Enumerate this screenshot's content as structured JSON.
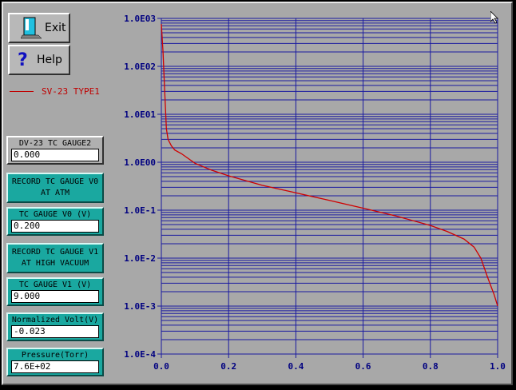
{
  "buttons": {
    "exit": "Exit",
    "help": "Help"
  },
  "legend": {
    "label": "SV-23 TYPE1",
    "color": "#c00000"
  },
  "panels": {
    "dv23": {
      "label": "DV-23 TC GAUGE2",
      "value": "0.000"
    },
    "record_v0": {
      "line1": "RECORD TC GAUGE V0",
      "line2": "AT ATM"
    },
    "tc_v0": {
      "label": "TC GAUGE V0 (V)",
      "value": "0.200"
    },
    "record_v1": {
      "line1": "RECORD TC GAUGE V1",
      "line2": "AT HIGH VACUUM"
    },
    "tc_v1": {
      "label": "TC GAUGE V1 (V)",
      "value": "9.000"
    },
    "norm_volt": {
      "label": "Normalized Volt(V)",
      "value": "-0.023"
    },
    "pressure": {
      "label": "Pressure(Torr)",
      "value": "7.6E+02"
    }
  },
  "chart_data": {
    "type": "line",
    "y_scale": "log",
    "ylim": [
      0.0001,
      1000
    ],
    "xlim": [
      0,
      1
    ],
    "y_tick_labels": [
      "1.0E03",
      "1.0E02",
      "1.0E01",
      "1.0E00",
      "1.0E-1",
      "1.0E-2",
      "1.0E-3",
      "1.0E-4"
    ],
    "x_tick_labels": [
      "0.0",
      "0.2",
      "0.4",
      "0.6",
      "0.8",
      "1.0"
    ],
    "grid": true,
    "colors": {
      "grid": "#1a1aa0",
      "axis_text": "#000080",
      "line": "#d00000"
    },
    "series": [
      {
        "name": "SV-23 TYPE1",
        "x": [
          0.0,
          0.005,
          0.01,
          0.015,
          0.02,
          0.03,
          0.04,
          0.06,
          0.1,
          0.15,
          0.2,
          0.3,
          0.4,
          0.5,
          0.6,
          0.7,
          0.8,
          0.85,
          0.9,
          0.93,
          0.95,
          0.97,
          0.99,
          1.0
        ],
        "y": [
          760,
          200,
          30,
          5,
          3,
          2.2,
          1.8,
          1.5,
          0.95,
          0.68,
          0.52,
          0.33,
          0.23,
          0.16,
          0.11,
          0.075,
          0.048,
          0.036,
          0.025,
          0.017,
          0.01,
          0.004,
          0.0017,
          0.001
        ]
      }
    ]
  }
}
